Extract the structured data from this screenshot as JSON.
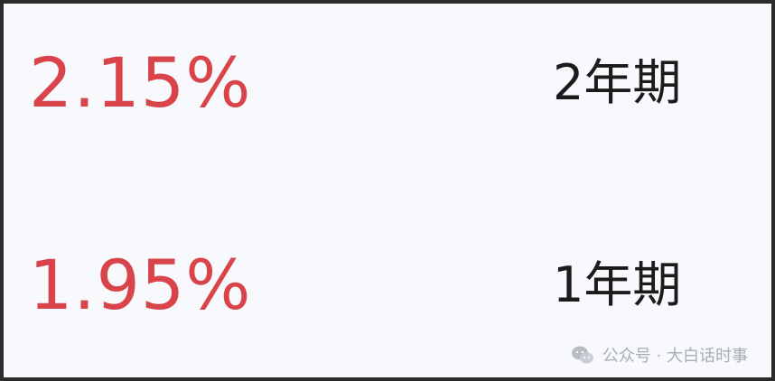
{
  "rates": [
    {
      "rate": "2.15%",
      "term": "2年期"
    },
    {
      "rate": "1.95%",
      "term": "1年期"
    }
  ],
  "watermark": {
    "text": "公众号 · 大白话时事",
    "icon": "wechat-icon"
  },
  "colors": {
    "rate": "#d9444b",
    "term": "#1b1b1b",
    "background": "#f7f9fc",
    "border": "#2b2b2b",
    "watermark": "#a9aeb5"
  }
}
